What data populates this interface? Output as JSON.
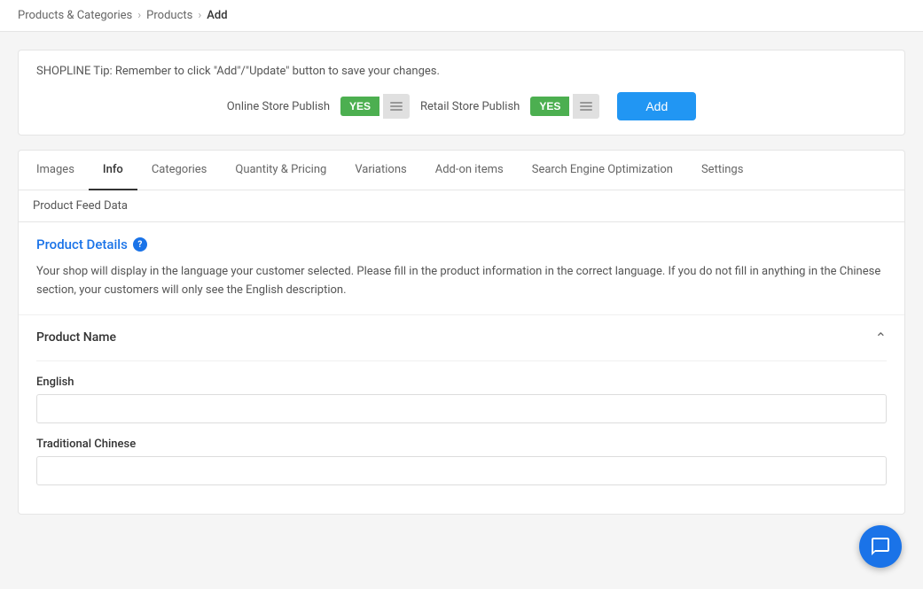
{
  "breadcrumb": {
    "part1": "Products & Categories",
    "part2": "Products",
    "part3": "Add"
  },
  "tip": {
    "text": "SHOPLINE Tip: Remember to click \"Add\"/\"Update\" button to save your changes."
  },
  "publish": {
    "online_label": "Online Store Publish",
    "online_value": "YES",
    "retail_label": "Retail Store Publish",
    "retail_value": "YES",
    "add_button": "Add"
  },
  "tabs": [
    {
      "id": "images",
      "label": "Images",
      "active": false
    },
    {
      "id": "info",
      "label": "Info",
      "active": true
    },
    {
      "id": "categories",
      "label": "Categories",
      "active": false
    },
    {
      "id": "quantity-pricing",
      "label": "Quantity & Pricing",
      "active": false
    },
    {
      "id": "variations",
      "label": "Variations",
      "active": false
    },
    {
      "id": "add-on-items",
      "label": "Add-on items",
      "active": false
    },
    {
      "id": "seo",
      "label": "Search Engine Optimization",
      "active": false
    },
    {
      "id": "settings",
      "label": "Settings",
      "active": false
    }
  ],
  "product_feed_bar": "Product Feed Data",
  "product_details": {
    "heading": "Product Details",
    "help_icon": "?",
    "info_text": "Your shop will display in the language your customer selected. Please fill in the product information in the correct language. If you do not fill in anything in the Chinese section, your customers will only see the English description."
  },
  "product_name": {
    "title": "Product Name",
    "english_label": "English",
    "english_placeholder": "",
    "chinese_label": "Traditional Chinese",
    "chinese_placeholder": ""
  }
}
